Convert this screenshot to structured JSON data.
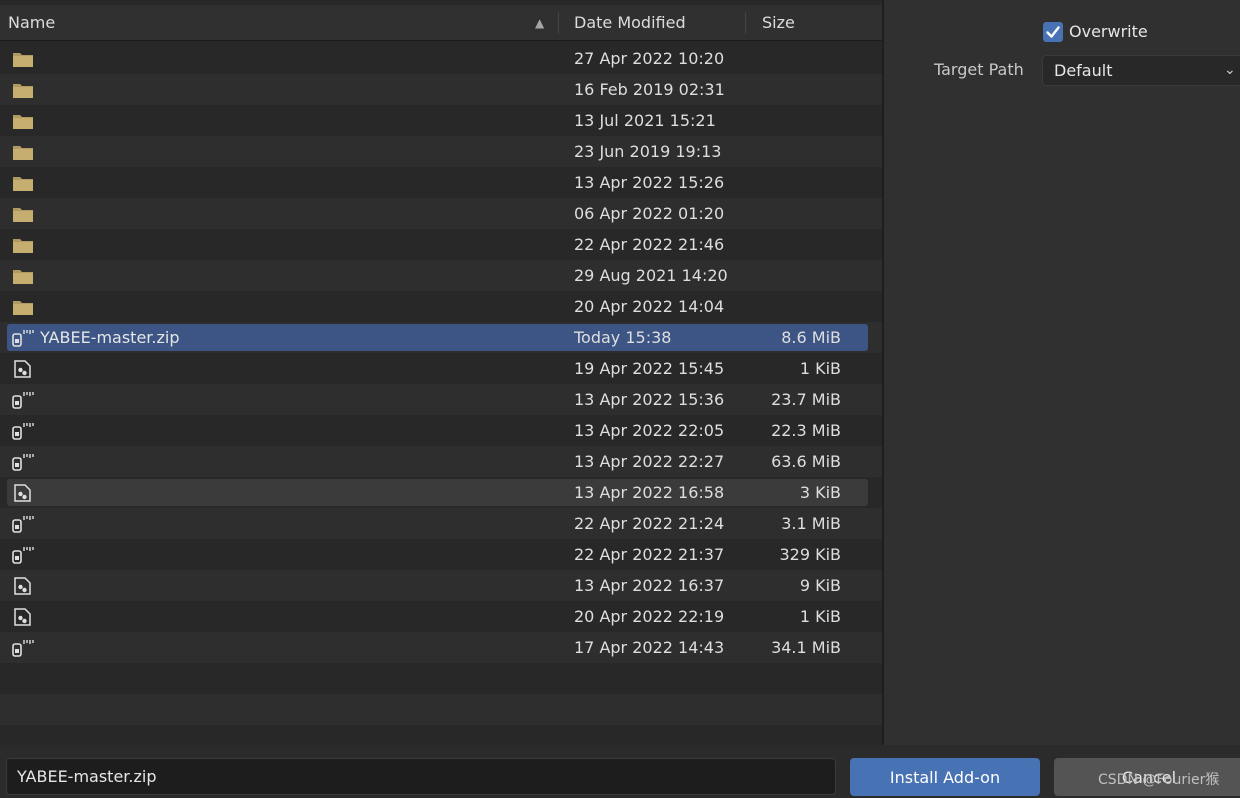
{
  "columns": {
    "name": "Name",
    "date": "Date Modified",
    "size": "Size"
  },
  "files": [
    {
      "name": "",
      "date": "27 Apr 2022 10:20",
      "size": "",
      "icon": "folder-icon"
    },
    {
      "name": "",
      "date": "16 Feb 2019 02:31",
      "size": "",
      "icon": "folder-icon"
    },
    {
      "name": "",
      "date": "13 Jul 2021 15:21",
      "size": "",
      "icon": "folder-icon"
    },
    {
      "name": "",
      "date": "23 Jun 2019 19:13",
      "size": "",
      "icon": "folder-icon"
    },
    {
      "name": "",
      "date": "13 Apr 2022 15:26",
      "size": "",
      "icon": "folder-icon"
    },
    {
      "name": "",
      "date": "06 Apr 2022 01:20",
      "size": "",
      "icon": "folder-icon"
    },
    {
      "name": "",
      "date": "22 Apr 2022 21:46",
      "size": "",
      "icon": "folder-icon"
    },
    {
      "name": "",
      "date": "29 Aug 2021 14:20",
      "size": "",
      "icon": "folder-icon"
    },
    {
      "name": "",
      "date": "20 Apr 2022 14:04",
      "size": "",
      "icon": "folder-icon"
    },
    {
      "name": "YABEE-master.zip",
      "date": "Today 15:38",
      "size": "8.6 MiB",
      "icon": "zip-file-icon"
    },
    {
      "name": "",
      "date": "19 Apr 2022 15:45",
      "size": "1 KiB",
      "icon": "python-file-icon"
    },
    {
      "name": "",
      "date": "13 Apr 2022 15:36",
      "size": "23.7 MiB",
      "icon": "zip-file-icon"
    },
    {
      "name": "",
      "date": "13 Apr 2022 22:05",
      "size": "22.3 MiB",
      "icon": "zip-file-icon"
    },
    {
      "name": "",
      "date": "13 Apr 2022 22:27",
      "size": "63.6 MiB",
      "icon": "zip-file-icon"
    },
    {
      "name": "",
      "date": "13 Apr 2022 16:58",
      "size": "3 KiB",
      "icon": "python-file-icon"
    },
    {
      "name": "",
      "date": "22 Apr 2022 21:24",
      "size": "3.1 MiB",
      "icon": "zip-file-icon"
    },
    {
      "name": "",
      "date": "22 Apr 2022 21:37",
      "size": "329 KiB",
      "icon": "zip-file-icon"
    },
    {
      "name": "",
      "date": "13 Apr 2022 16:37",
      "size": "9 KiB",
      "icon": "python-file-icon"
    },
    {
      "name": "",
      "date": "20 Apr 2022 22:19",
      "size": "1 KiB",
      "icon": "python-file-icon"
    },
    {
      "name": "",
      "date": "17 Apr 2022 14:43",
      "size": "34.1 MiB",
      "icon": "zip-file-icon"
    }
  ],
  "selected_index": 9,
  "hover_index": 14,
  "options": {
    "overwrite_label": "Overwrite",
    "overwrite_checked": true,
    "target_path_label": "Target Path",
    "target_path_value": "Default"
  },
  "footer": {
    "filename_value": "YABEE-master.zip",
    "install_label": "Install Add-on",
    "cancel_label": "Cancel"
  },
  "watermark": "CSDN @Fourier猴",
  "colors": {
    "accent": "#4772b3",
    "selection": "#3c5585",
    "folder": "#b19a61"
  }
}
